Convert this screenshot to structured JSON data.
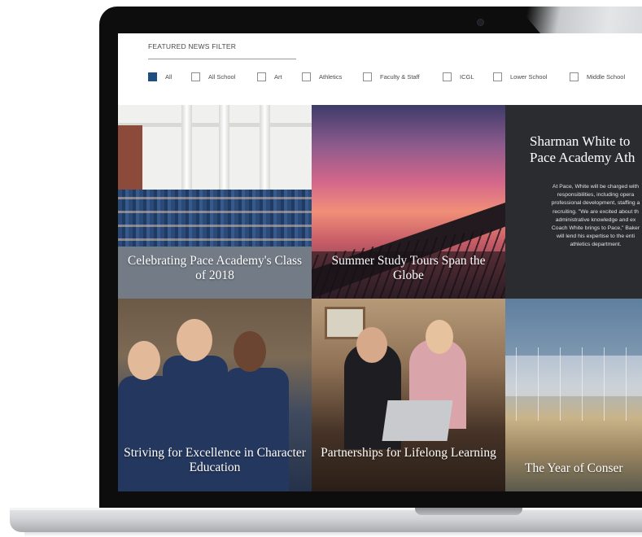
{
  "filter": {
    "title": "FEATURED NEWS FILTER",
    "options": [
      {
        "label": "All",
        "checked": true
      },
      {
        "label": "All School",
        "checked": false
      },
      {
        "label": "Art",
        "checked": false
      },
      {
        "label": "Athletics",
        "checked": false
      },
      {
        "label": "Faculty & Staff",
        "checked": false
      },
      {
        "label": "ICGL",
        "checked": false
      },
      {
        "label": "Lower School",
        "checked": false
      },
      {
        "label": "Middle School",
        "checked": false
      }
    ]
  },
  "tiles": [
    {
      "title": "Celebrating Pace Academy's Class of 2018"
    },
    {
      "title": "Summer Study Tours Span the Globe"
    },
    {
      "title_line1": "Sharman White to",
      "title_line2": "Pace Academy Ath",
      "body": "At Pace, White will be charged with\nresponsibilities, including opera\nprofessional development, staffing a\nrecruiting. \"We are excited about th\nadministrative knowledge and ex\nCoach White brings to Pace,\" Baker\nwill lend his expertise to the enti\nathletics department."
    },
    {
      "title": "Striving for Excellence in Character Education"
    },
    {
      "title": "Partnerships for Lifelong Learning"
    },
    {
      "title": "The Year of Conser"
    }
  ],
  "colors": {
    "checked_box": "#1f4f80",
    "dark_tile": "#2b2c30",
    "bezel": "#0d0d0d"
  }
}
